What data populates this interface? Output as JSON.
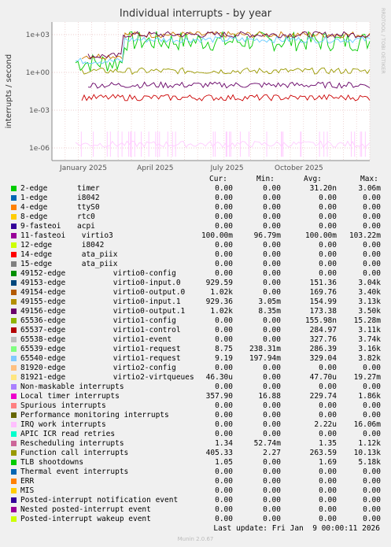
{
  "title": "Individual interrupts - by year",
  "ylabel": "interrupts / second",
  "side_text": "RRDTOOL / TOBI OETIKER",
  "headers": {
    "cur": "Cur:",
    "min": "Min:",
    "avg": "Avg:",
    "max": "Max:"
  },
  "last_update": "Last update: Fri Jan  9 00:00:11 2026",
  "munin": "Munin 2.0.67",
  "chart_data": {
    "type": "line",
    "title": "Individual interrupts - by year",
    "ylabel": "interrupts / second",
    "yscale": "log",
    "ylim": [
      1e-07,
      10000
    ],
    "yticks": [
      "1e-06",
      "1e-03",
      "1e+00",
      "1e+03"
    ],
    "xticks": [
      "January 2025",
      "April 2025",
      "July 2025",
      "October 2025"
    ],
    "grid": true,
    "series": [
      {
        "name": "Local timer interrupts",
        "color": "#00cc00",
        "level": 300
      },
      {
        "name": "49154-edge virtio0-output.0",
        "color": "#cc7a00",
        "level": 1000
      },
      {
        "name": "49156-edge virtio0-output.1",
        "color": "#66004d",
        "level": 1000
      },
      {
        "name": "Function call interrupts",
        "color": "#66ccff",
        "level": 400
      },
      {
        "name": "Rescheduling interrupts",
        "color": "#999900",
        "level": 1.3
      },
      {
        "name": "11-fasteoi virtio3",
        "color": "#660066",
        "level": 0.1
      },
      {
        "name": "IRQ work interrupts",
        "color": "#ffccff",
        "level": 2e-06
      },
      {
        "name": "65540-edge virtio1-request",
        "color": "#cc0000",
        "level": 0.01
      }
    ]
  },
  "rows": [
    {
      "color": "#00cc00",
      "name": "2-edge",
      "desc": "timer",
      "cur": "0.00",
      "min": "0.00",
      "avg": "31.20n",
      "max": "3.06m"
    },
    {
      "color": "#0066b3",
      "name": "1-edge",
      "desc": "i8042",
      "cur": "0.00",
      "min": "0.00",
      "avg": "0.00",
      "max": "0.00"
    },
    {
      "color": "#ff8000",
      "name": "4-edge",
      "desc": "ttyS0",
      "cur": "0.00",
      "min": "0.00",
      "avg": "0.00",
      "max": "0.00"
    },
    {
      "color": "#ffcc00",
      "name": "8-edge",
      "desc": "rtc0",
      "cur": "0.00",
      "min": "0.00",
      "avg": "0.00",
      "max": "0.00"
    },
    {
      "color": "#330099",
      "name": "9-fasteoi",
      "desc": "acpi",
      "cur": "0.00",
      "min": "0.00",
      "avg": "0.00",
      "max": "0.00"
    },
    {
      "color": "#990099",
      "name": "11-fasteoi",
      "desc": " virtio3",
      "cur": "100.00m",
      "min": "96.79m",
      "avg": "100.00m",
      "max": "103.22m"
    },
    {
      "color": "#ccff00",
      "name": "12-edge",
      "desc": " i8042",
      "cur": "0.00",
      "min": "0.00",
      "avg": "0.00",
      "max": "0.00"
    },
    {
      "color": "#ff0000",
      "name": "14-edge",
      "desc": " ata_piix",
      "cur": "0.00",
      "min": "0.00",
      "avg": "0.00",
      "max": "0.00"
    },
    {
      "color": "#808080",
      "name": "15-edge",
      "desc": " ata_piix",
      "cur": "0.00",
      "min": "0.00",
      "avg": "0.00",
      "max": "0.00"
    },
    {
      "color": "#008f00",
      "name": "49152-edge",
      "desc": "        virtio0-config",
      "cur": "0.00",
      "min": "0.00",
      "avg": "0.00",
      "max": "0.00"
    },
    {
      "color": "#00487d",
      "name": "49153-edge",
      "desc": "        virtio0-input.0",
      "cur": "929.59",
      "min": "0.00",
      "avg": "151.36",
      "max": "3.04k"
    },
    {
      "color": "#b35a00",
      "name": "49154-edge",
      "desc": "        virtio0-output.0",
      "cur": "1.02k",
      "min": "0.00",
      "avg": "169.76",
      "max": "3.40k"
    },
    {
      "color": "#b38f00",
      "name": "49155-edge",
      "desc": "        virtio0-input.1",
      "cur": "929.36",
      "min": "3.05m",
      "avg": "154.99",
      "max": "3.13k"
    },
    {
      "color": "#6b006b",
      "name": "49156-edge",
      "desc": "        virtio0-output.1",
      "cur": "1.02k",
      "min": "8.35m",
      "avg": "173.38",
      "max": "3.50k"
    },
    {
      "color": "#8fb300",
      "name": "65536-edge",
      "desc": "        virtio1-config",
      "cur": "0.00",
      "min": "0.00",
      "avg": "155.98n",
      "max": "15.28m"
    },
    {
      "color": "#b30000",
      "name": "65537-edge",
      "desc": "        virtio1-control",
      "cur": "0.00",
      "min": "0.00",
      "avg": "284.97",
      "max": "3.11k"
    },
    {
      "color": "#bebebe",
      "name": "65538-edge",
      "desc": "        virtio1-event",
      "cur": "0.00",
      "min": "0.00",
      "avg": "327.76",
      "max": "3.74k"
    },
    {
      "color": "#80ff80",
      "name": "65539-edge",
      "desc": "        virtio1-request",
      "cur": "8.75",
      "min": "238.31m",
      "avg": "286.39",
      "max": "3.16k"
    },
    {
      "color": "#80c9ff",
      "name": "65540-edge",
      "desc": "        virtio1-request",
      "cur": "9.19",
      "min": "197.94m",
      "avg": "329.04",
      "max": "3.82k"
    },
    {
      "color": "#ffc080",
      "name": "81920-edge",
      "desc": "        virtio2-config",
      "cur": "0.00",
      "min": "0.00",
      "avg": "0.00",
      "max": "0.00"
    },
    {
      "color": "#ffe680",
      "name": "81921-edge",
      "desc": "        virtio2-virtqueues",
      "cur": "46.30u",
      "min": "0.00",
      "avg": "47.70u",
      "max": "19.27m"
    },
    {
      "color": "#aa80ff",
      "name": "Non-maskable interrupts",
      "desc": "",
      "cur": "0.00",
      "min": "0.00",
      "avg": "0.00",
      "max": "0.00"
    },
    {
      "color": "#ee00cc",
      "name": "Local timer interrupts",
      "desc": "",
      "cur": "357.90",
      "min": "16.88",
      "avg": "229.74",
      "max": "1.86k"
    },
    {
      "color": "#ff8080",
      "name": "Spurious interrupts",
      "desc": "",
      "cur": "0.00",
      "min": "0.00",
      "avg": "0.00",
      "max": "0.00"
    },
    {
      "color": "#666600",
      "name": "Performance monitoring interrupts",
      "desc": "",
      "cur": "0.00",
      "min": "0.00",
      "avg": "0.00",
      "max": "0.00"
    },
    {
      "color": "#ffbfff",
      "name": "IRQ work interrupts",
      "desc": "",
      "cur": "0.00",
      "min": "0.00",
      "avg": "2.22u",
      "max": "16.06m"
    },
    {
      "color": "#00ffcc",
      "name": "APIC ICR read retries",
      "desc": "",
      "cur": "0.00",
      "min": "0.00",
      "avg": "0.00",
      "max": "0.00"
    },
    {
      "color": "#cc6699",
      "name": "Rescheduling interrupts",
      "desc": "",
      "cur": "1.34",
      "min": "52.74m",
      "avg": "1.35",
      "max": "1.12k"
    },
    {
      "color": "#999900",
      "name": "Function call interrupts",
      "desc": "",
      "cur": "405.33",
      "min": "2.27",
      "avg": "263.59",
      "max": "10.13k"
    },
    {
      "color": "#00cc00",
      "name": "TLB shootdowns",
      "desc": "",
      "cur": "1.05",
      "min": "0.00",
      "avg": "1.69",
      "max": "5.18k"
    },
    {
      "color": "#0066b3",
      "name": "Thermal event interrupts",
      "desc": "",
      "cur": "0.00",
      "min": "0.00",
      "avg": "0.00",
      "max": "0.00"
    },
    {
      "color": "#ff8000",
      "name": "ERR",
      "desc": "",
      "cur": "0.00",
      "min": "0.00",
      "avg": "0.00",
      "max": "0.00"
    },
    {
      "color": "#ffcc00",
      "name": "MIS",
      "desc": "",
      "cur": "0.00",
      "min": "0.00",
      "avg": "0.00",
      "max": "0.00"
    },
    {
      "color": "#330099",
      "name": "Posted-interrupt notification event",
      "desc": "",
      "cur": "0.00",
      "min": "0.00",
      "avg": "0.00",
      "max": "0.00"
    },
    {
      "color": "#990099",
      "name": "Nested posted-interrupt event",
      "desc": "",
      "cur": "0.00",
      "min": "0.00",
      "avg": "0.00",
      "max": "0.00"
    },
    {
      "color": "#ccff00",
      "name": "Posted-interrupt wakeup event",
      "desc": "",
      "cur": "0.00",
      "min": "0.00",
      "avg": "0.00",
      "max": "0.00"
    }
  ]
}
